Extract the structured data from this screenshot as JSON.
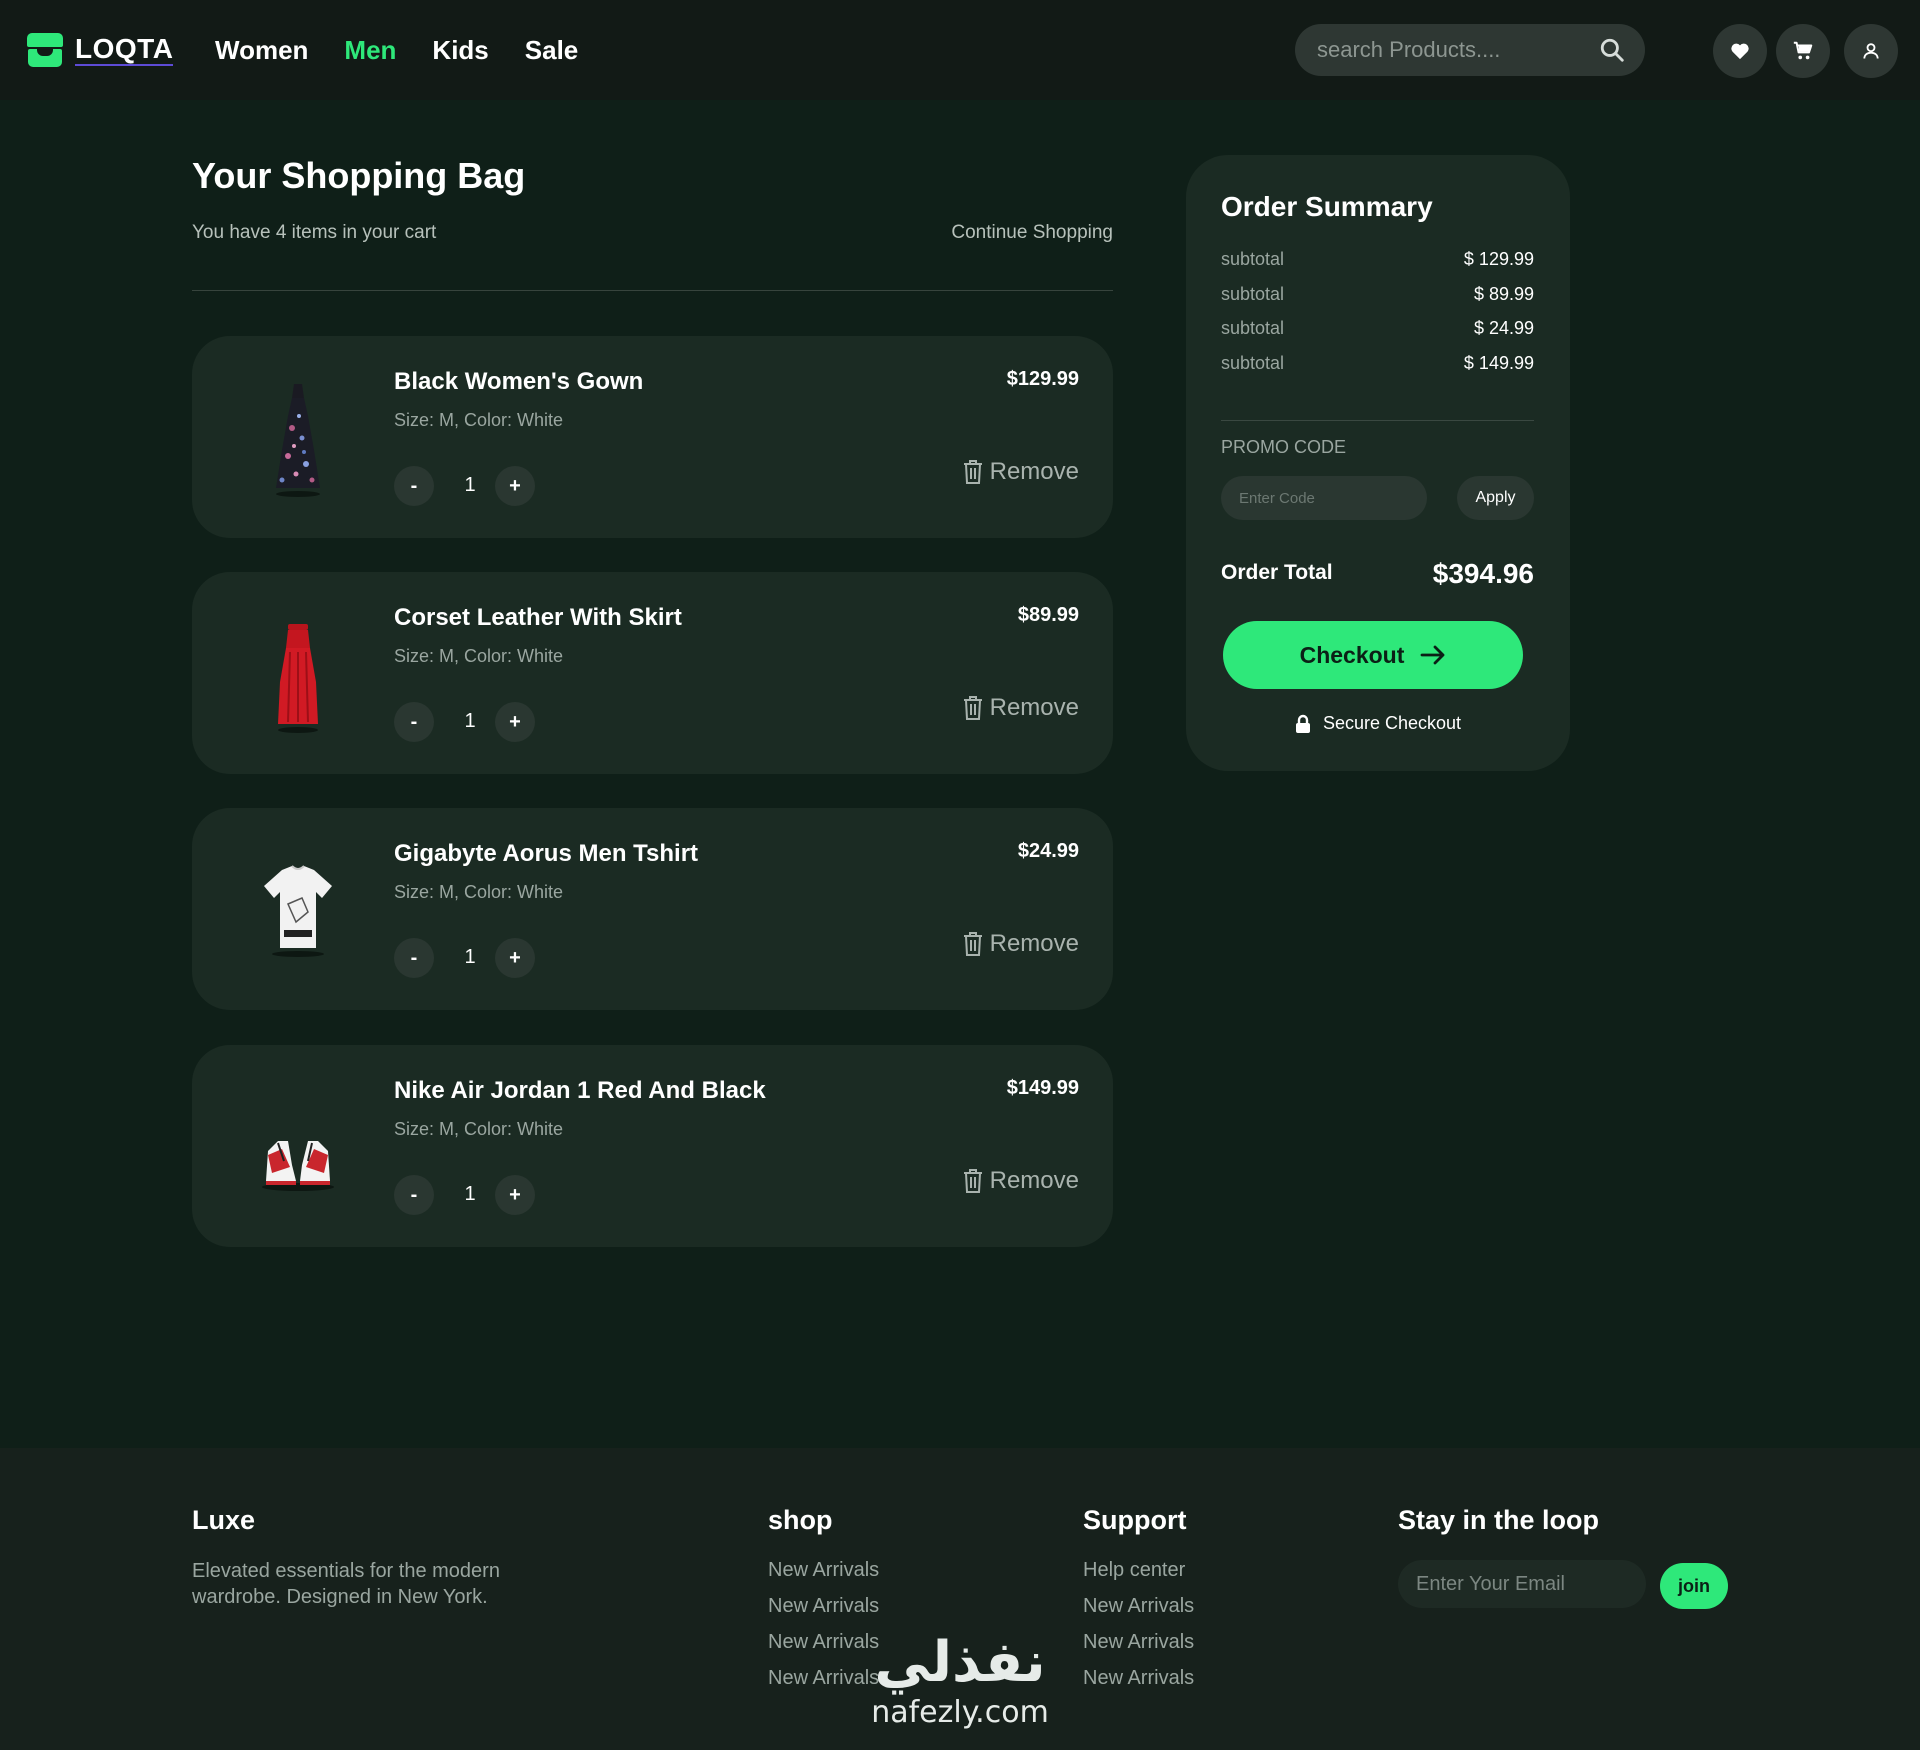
{
  "nav": {
    "logo_text": "LOQTA",
    "links": [
      "Women",
      "Men",
      "Kids",
      "Sale"
    ],
    "active_link": "Men",
    "search_placeholder": "search Products...."
  },
  "bag": {
    "title": "Your Shopping Bag",
    "count_text": "You have 4 items in your cart",
    "continue_label": "Continue Shopping",
    "remove_label": "Remove",
    "items": [
      {
        "name": "Black Women's Gown",
        "meta": "Size: M, Color: White",
        "price": "$129.99",
        "qty": "1",
        "image": "black-floral-gown"
      },
      {
        "name": "Corset Leather With Skirt",
        "meta": "Size: M, Color: White",
        "price": "$89.99",
        "qty": "1",
        "image": "red-corset-dress"
      },
      {
        "name": "Gigabyte Aorus Men Tshirt",
        "meta": "Size: M, Color: White",
        "price": "$24.99",
        "qty": "1",
        "image": "white-aorus-tshirt"
      },
      {
        "name": "Nike Air Jordan 1 Red And Black",
        "meta": "Size: M, Color: White",
        "price": "$149.99",
        "qty": "1",
        "image": "red-white-sneakers"
      }
    ],
    "qty_minus": "-",
    "qty_plus": "+"
  },
  "summary": {
    "title": "Order Summary",
    "rows": [
      {
        "label": "subtotal",
        "value": "$ 129.99"
      },
      {
        "label": "subtotal",
        "value": "$ 89.99"
      },
      {
        "label": "subtotal",
        "value": "$ 24.99"
      },
      {
        "label": "subtotal",
        "value": "$ 149.99"
      }
    ],
    "promo_label": "PROMO CODE",
    "promo_placeholder": "Enter Code",
    "apply_label": "Apply",
    "total_label": "Order Total",
    "total_value": "$394.96",
    "checkout_label": "Checkout",
    "secure_label": "Secure Checkout"
  },
  "footer": {
    "brand": "Luxe",
    "tagline": "Elevated essentials for the modern wardrobe. Designed in New York.",
    "shop_title": "shop",
    "shop_links": [
      "New Arrivals",
      "New Arrivals",
      "New Arrivals",
      "New Arrivals"
    ],
    "support_title": "Support",
    "support_links": [
      "Help center",
      "New Arrivals",
      "New Arrivals",
      "New Arrivals"
    ],
    "newsletter_title": "Stay in the loop",
    "email_placeholder": "Enter Your Email",
    "join_label": "join"
  },
  "watermark": {
    "arabic": "نفذلي",
    "latin": "nafezly.com"
  },
  "colors": {
    "accent": "#2ee87a",
    "background": "#0f1f18",
    "card": "#1b2b23",
    "nav": "#121a16"
  },
  "icons": [
    "search-icon",
    "heart-icon",
    "cart-icon",
    "user-icon",
    "trash-icon",
    "arrow-right-icon",
    "lock-icon"
  ]
}
